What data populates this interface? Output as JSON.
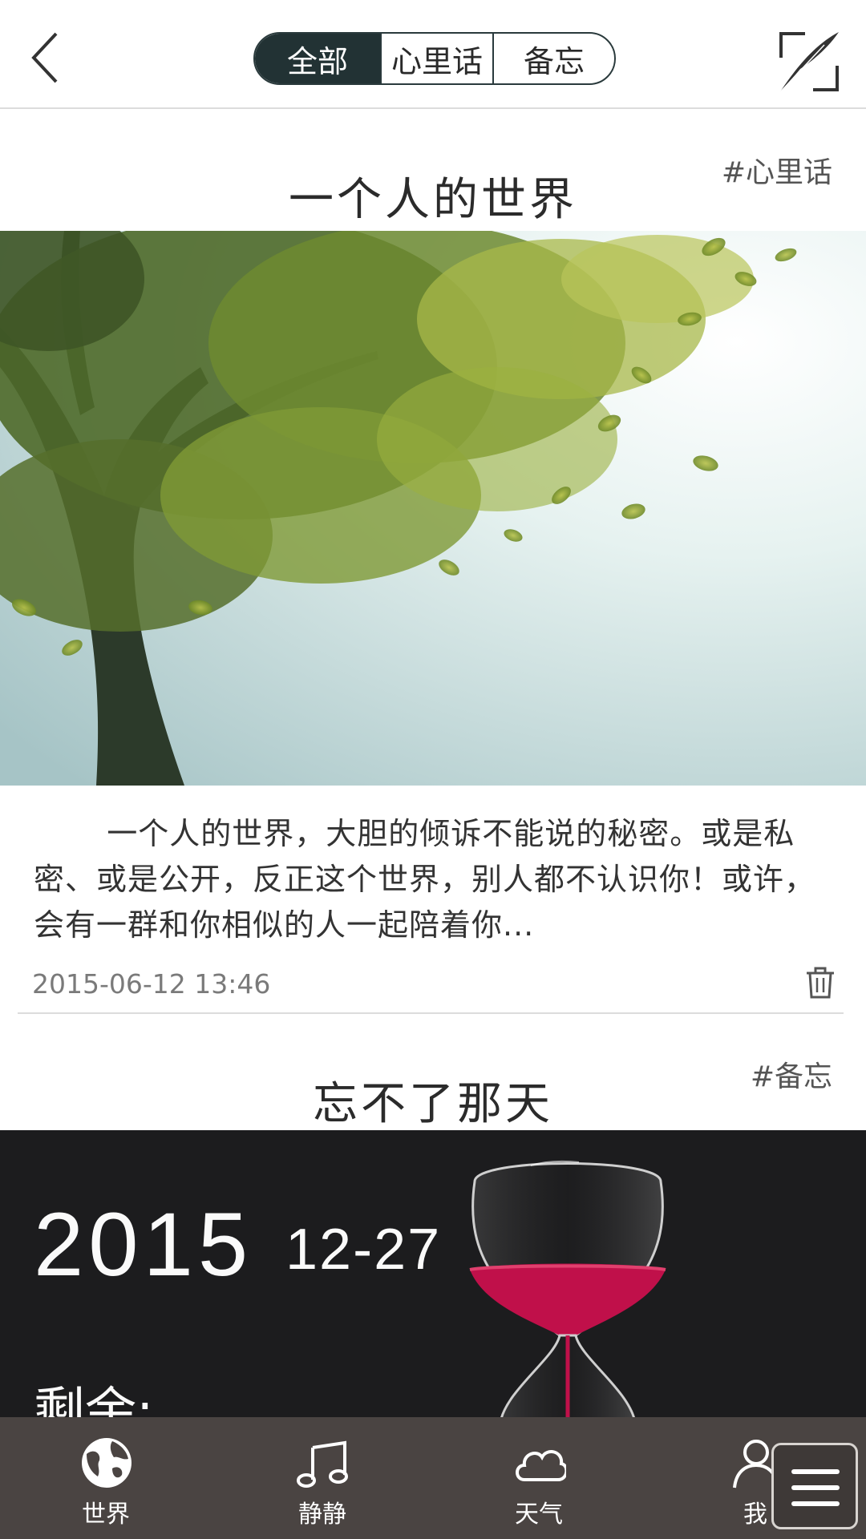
{
  "header": {
    "tabs": [
      {
        "label": "全部",
        "active": true
      },
      {
        "label": "心里话",
        "active": false
      },
      {
        "label": "备忘",
        "active": false
      }
    ]
  },
  "posts": [
    {
      "title": "一个人的世界",
      "tag": "#心里话",
      "excerpt": "一个人的世界，大胆的倾诉不能说的秘密。或是私密、或是公开，反正这个世界，别人都不认识你！或许，会有一群和你相似的人一起陪着你...",
      "date": "2015-06-12 13:46"
    },
    {
      "title": "忘不了那天",
      "tag": "#备忘",
      "image_text": {
        "year": "2015",
        "month_day": "12-27",
        "remain": "剩余:"
      }
    }
  ],
  "bottom_nav": {
    "items": [
      {
        "label": "世界",
        "icon": "globe-icon"
      },
      {
        "label": "静静",
        "icon": "music-note-icon"
      },
      {
        "label": "天气",
        "icon": "cloud-icon"
      },
      {
        "label": "我",
        "icon": "person-icon"
      }
    ],
    "menu_icon": "menu-icon"
  },
  "colors": {
    "accent": "#223234",
    "nav_bg": "#4a4442",
    "hourglass_sand": "#c0104a"
  }
}
